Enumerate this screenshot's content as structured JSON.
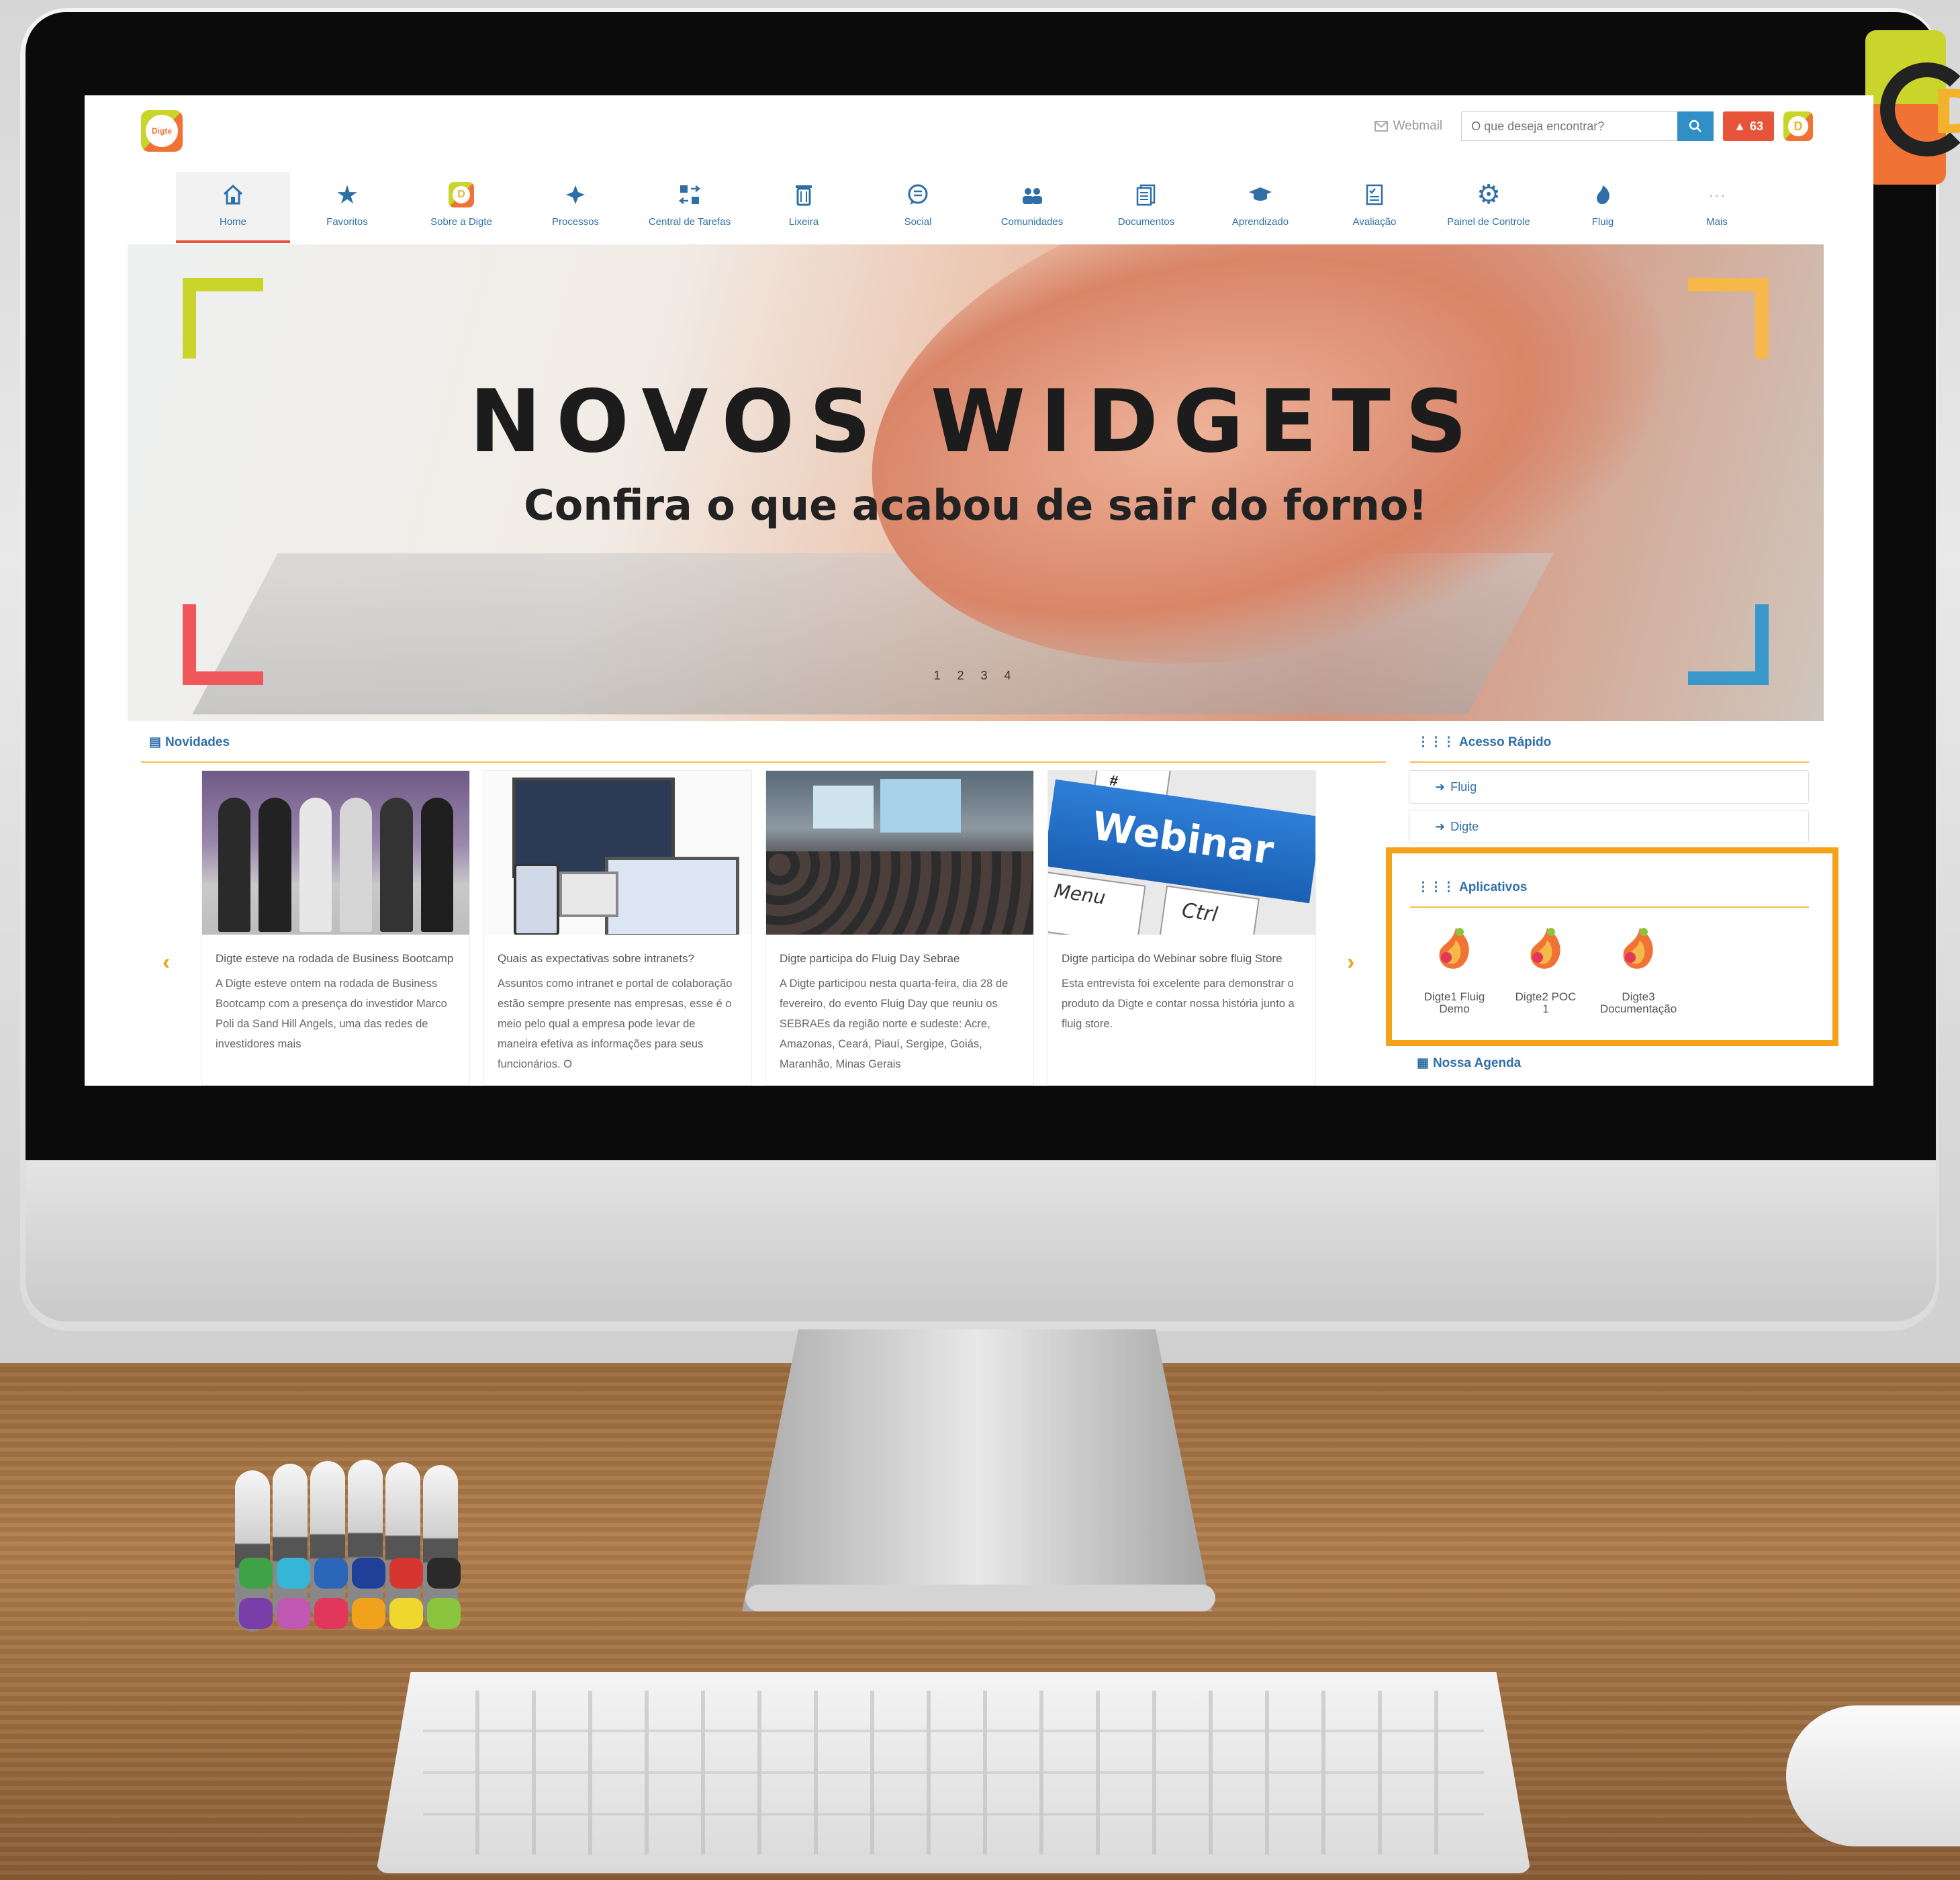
{
  "header": {
    "logo_text": "Digte",
    "webmail_label": "Webmail",
    "search_placeholder": "O que deseja encontrar?",
    "alerts_count": "63"
  },
  "nav": [
    {
      "label": "Home",
      "icon": "home-icon",
      "active": true
    },
    {
      "label": "Favoritos",
      "icon": "star-icon"
    },
    {
      "label": "Sobre a Digte",
      "icon": "digte-logo-icon"
    },
    {
      "label": "Processos",
      "icon": "process-icon"
    },
    {
      "label": "Central de Tarefas",
      "icon": "tasks-icon"
    },
    {
      "label": "Lixeira",
      "icon": "trash-icon"
    },
    {
      "label": "Social",
      "icon": "chat-icon"
    },
    {
      "label": "Comunidades",
      "icon": "communities-icon"
    },
    {
      "label": "Documentos",
      "icon": "documents-icon"
    },
    {
      "label": "Aprendizado",
      "icon": "graduation-cap-icon"
    },
    {
      "label": "Avaliação",
      "icon": "evaluation-icon"
    },
    {
      "label": "Painel de Controle",
      "icon": "gear-icon"
    },
    {
      "label": "Fluig",
      "icon": "fluig-icon"
    },
    {
      "label": "Mais",
      "icon": "more-icon"
    }
  ],
  "banner": {
    "title": "NOVOS WIDGETS",
    "subtitle": "Confira o que acabou de sair do forno!",
    "pager": "1 2 3 4"
  },
  "news": {
    "title": "Novidades",
    "cards": [
      {
        "title": "Digte esteve na rodada de Business Bootcamp",
        "text": "A Digte esteve ontem na rodada de Business Bootcamp com a presença do investidor Marco Poli da Sand Hill Angels, uma das redes de investidores mais"
      },
      {
        "title": "Quais as expectativas sobre intranets?",
        "text": "Assuntos como intranet e portal de colaboração estão sempre presente nas empresas, esse é o meio pelo qual a empresa pode levar de maneira efetiva as informações para seus funcionários. O"
      },
      {
        "title": "Digte participa do Fluig Day Sebrae",
        "text": "A Digte participou nesta quarta-feira, dia 28 de fevereiro, do evento Fluig Day que reuniu os SEBRAEs da região norte e sudeste: Acre, Amazonas, Ceará, Piauí, Sergipe, Goiás, Maranhão, Minas Gerais"
      },
      {
        "title": "Digte participa do Webinar sobre fluig Store",
        "text": "Esta entrevista foi excelente para demonstrar o produto da Digte e contar nossa história junto a fluig store."
      }
    ],
    "webinar_key_text": "Webinar",
    "menu_key_text": "Menu",
    "ctrl_key_text": "Ctrl",
    "hash_key_text": "#"
  },
  "quick_access": {
    "title": "Acesso Rápido",
    "links": [
      "Fluig",
      "Digte"
    ]
  },
  "apps": {
    "title": "Aplicativos",
    "items": [
      {
        "line1": "Digte1 Fluig",
        "line2": "Demo"
      },
      {
        "line1": "Digte2 POC",
        "line2": "1"
      },
      {
        "line1": "Digte3",
        "line2": "Documentação"
      }
    ]
  },
  "agenda": {
    "title": "Nossa Agenda"
  },
  "colors": {
    "accent": "#2f6fa8",
    "alert": "#e8543a",
    "highlight": "#f4a21a",
    "brand_green": "#c9d52a",
    "brand_orange": "#f07335"
  }
}
